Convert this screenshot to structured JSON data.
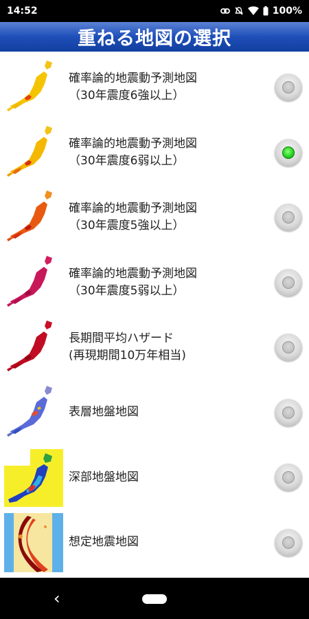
{
  "status": {
    "time": "14:52",
    "battery": "100%"
  },
  "title": "重ねる地図の選択",
  "options": [
    {
      "line1": "確率論的地震動予測地図",
      "line2": "（30年震度6強以上）",
      "selected": false,
      "thumb": "japan-map-yellow"
    },
    {
      "line1": "確率論的地震動予測地図",
      "line2": "（30年震度6弱以上）",
      "selected": true,
      "thumb": "japan-map-yellow-orange"
    },
    {
      "line1": "確率論的地震動予測地図",
      "line2": "（30年震度5強以上）",
      "selected": false,
      "thumb": "japan-map-orange-red"
    },
    {
      "line1": "確率論的地震動予測地図",
      "line2": "（30年震度5弱以上）",
      "selected": false,
      "thumb": "japan-map-magenta"
    },
    {
      "line1": "長期間平均ハザード",
      "line2": "(再現期間10万年相当)",
      "selected": false,
      "thumb": "japan-map-crimson"
    },
    {
      "line1": "表層地盤地図",
      "line2": "",
      "selected": false,
      "thumb": "japan-map-blue"
    },
    {
      "line1": "深部地盤地図",
      "line2": "",
      "selected": false,
      "thumb": "japan-map-deep"
    },
    {
      "line1": "想定地震地図",
      "line2": "",
      "selected": false,
      "thumb": "japan-map-scenario"
    }
  ],
  "colors": {
    "selected": "#22cc22",
    "title_bar": "#1e4fb8"
  }
}
